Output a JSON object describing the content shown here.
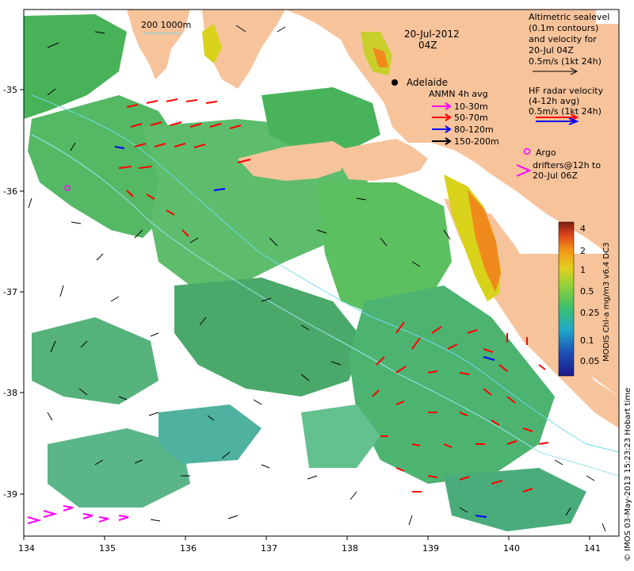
{
  "map": {
    "date_label": "20-Jul-2012",
    "time_label": "04Z",
    "city": "Adelaide",
    "scale_label": "200  1000m",
    "altimetry_legend": [
      "Altimetric sealevel",
      "(0.1m contours)",
      "and velocity for",
      "20-Jul 04Z",
      "0.5m/s (1kt 24h)"
    ],
    "hf_legend": [
      "HF radar velocity",
      "(4-12h avg)",
      "0.5m/s (1kt 24h)"
    ],
    "anmn_title": "ANMN 4h avg",
    "anmn_items": [
      {
        "label": "10-30m",
        "color": "#ff00ff"
      },
      {
        "label": "50-70m",
        "color": "#ff0000"
      },
      {
        "label": "80-120m",
        "color": "#0000ff"
      },
      {
        "label": "150-200m",
        "color": "#000000"
      }
    ],
    "argo_label": "Argo",
    "drifter_legend": [
      "drifters@12h to",
      "20-Jul 06Z"
    ],
    "colorbar_title": "MODIS Chl-a mg/m3 v6.4 DC3",
    "colorbar_ticks": [
      "4",
      "2",
      "1",
      "0.5",
      "0.25",
      "0.1",
      "0.05"
    ],
    "credit": "© IMOS 03-May-2013 15:23:23 Hobart time",
    "x_ticks": [
      "134",
      "135",
      "136",
      "137",
      "138",
      "139",
      "140",
      "141"
    ],
    "y_ticks": [
      "-35",
      "-36",
      "-37",
      "-38",
      "-39"
    ],
    "colors": {
      "land": "#f7c39b",
      "water_high": "#3fae57",
      "water_mid": "#6cc17a",
      "water_low": "#4fb1a0",
      "coastal_yellow": "#d8d21a",
      "coastal_orange": "#f08a1c",
      "anmn_red": "#ff0000",
      "hf_blue": "#0000ff",
      "drifter_magenta": "#ff00ff"
    }
  }
}
